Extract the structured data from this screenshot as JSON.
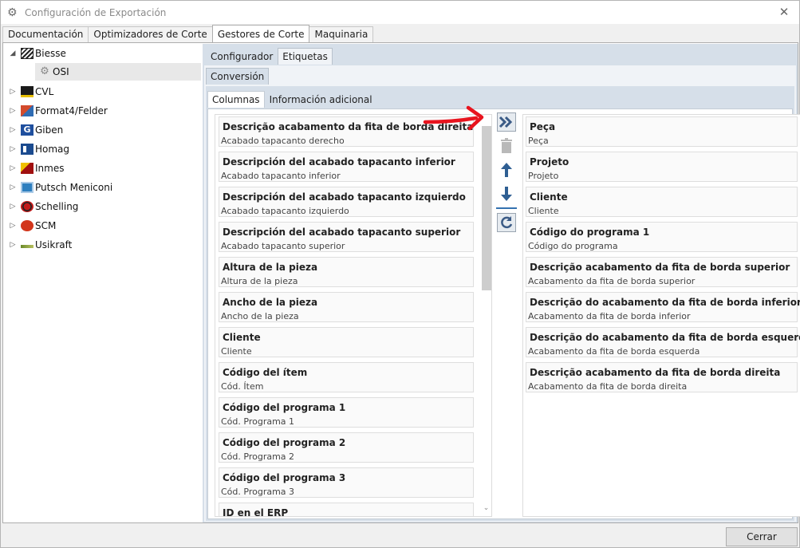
{
  "window": {
    "title": "Configuración de Exportación",
    "close_label": "✕"
  },
  "top_tabs": [
    {
      "label": "Documentación"
    },
    {
      "label": "Optimizadores de Corte"
    },
    {
      "label": "Gestores de Corte",
      "active": true
    },
    {
      "label": "Maquinaria"
    }
  ],
  "tree": {
    "items": [
      {
        "label": "Biesse",
        "expanded": true
      },
      {
        "label": "OSI",
        "child": true,
        "selected": true
      },
      {
        "label": "CVL"
      },
      {
        "label": "Format4/Felder"
      },
      {
        "label": "Giben"
      },
      {
        "label": "Homag"
      },
      {
        "label": "Inmes"
      },
      {
        "label": "Putsch Meniconi"
      },
      {
        "label": "Schelling"
      },
      {
        "label": "SCM"
      },
      {
        "label": "Usikraft"
      }
    ]
  },
  "subtabs1": [
    {
      "label": "Configurador"
    },
    {
      "label": "Etiquetas",
      "active": true
    }
  ],
  "subtabs2": [
    {
      "label": "Conversión",
      "active": true
    }
  ],
  "subtabs3": [
    {
      "label": "Columnas",
      "active": true
    },
    {
      "label": "Información adicional"
    }
  ],
  "available_columns": [
    {
      "title": "Descrição acabamento da fita de borda direita",
      "subtitle": "Acabado tapacanto derecho"
    },
    {
      "title": "Descripción del acabado tapacanto inferior",
      "subtitle": "Acabado tapacanto inferior"
    },
    {
      "title": "Descripción del acabado tapacanto izquierdo",
      "subtitle": "Acabado tapacanto izquierdo"
    },
    {
      "title": "Descripción del acabado tapacanto superior",
      "subtitle": "Acabado tapacanto superior"
    },
    {
      "title": "Altura de la pieza",
      "subtitle": "Altura de la pieza"
    },
    {
      "title": "Ancho de la pieza",
      "subtitle": "Ancho de la pieza"
    },
    {
      "title": "Cliente",
      "subtitle": "Cliente"
    },
    {
      "title": "Código del ítem",
      "subtitle": "Cód. Ítem"
    },
    {
      "title": "Código del programa 1",
      "subtitle": "Cód. Programa 1"
    },
    {
      "title": "Código del programa 2",
      "subtitle": "Cód. Programa 2"
    },
    {
      "title": "Código del programa 3",
      "subtitle": "Cód. Programa 3"
    },
    {
      "title": "ID en el ERP",
      "subtitle": ""
    }
  ],
  "selected_columns": [
    {
      "title": "Peça",
      "subtitle": "Peça"
    },
    {
      "title": "Projeto",
      "subtitle": "Projeto"
    },
    {
      "title": "Cliente",
      "subtitle": "Cliente"
    },
    {
      "title": "Código do programa 1",
      "subtitle": "Código do programa"
    },
    {
      "title": "Descrição acabamento da fita de borda superior",
      "subtitle": "Acabamento da fita de borda superior"
    },
    {
      "title": "Descrição do acabamento da fita de borda inferior",
      "subtitle": "Acabamento da fita de borda inferior"
    },
    {
      "title": "Descrição do acabamento da fita de borda esquerda",
      "subtitle": "Acabamento da fita de borda esquerda"
    },
    {
      "title": "Descrição acabamento da fita de borda direita",
      "subtitle": "Acabamento da fita de borda direita"
    }
  ],
  "buttons": {
    "close": "Cerrar"
  },
  "colors": {
    "accent": "#3572b0",
    "panel": "#d6dfe9",
    "annotation": "#e8141e"
  }
}
